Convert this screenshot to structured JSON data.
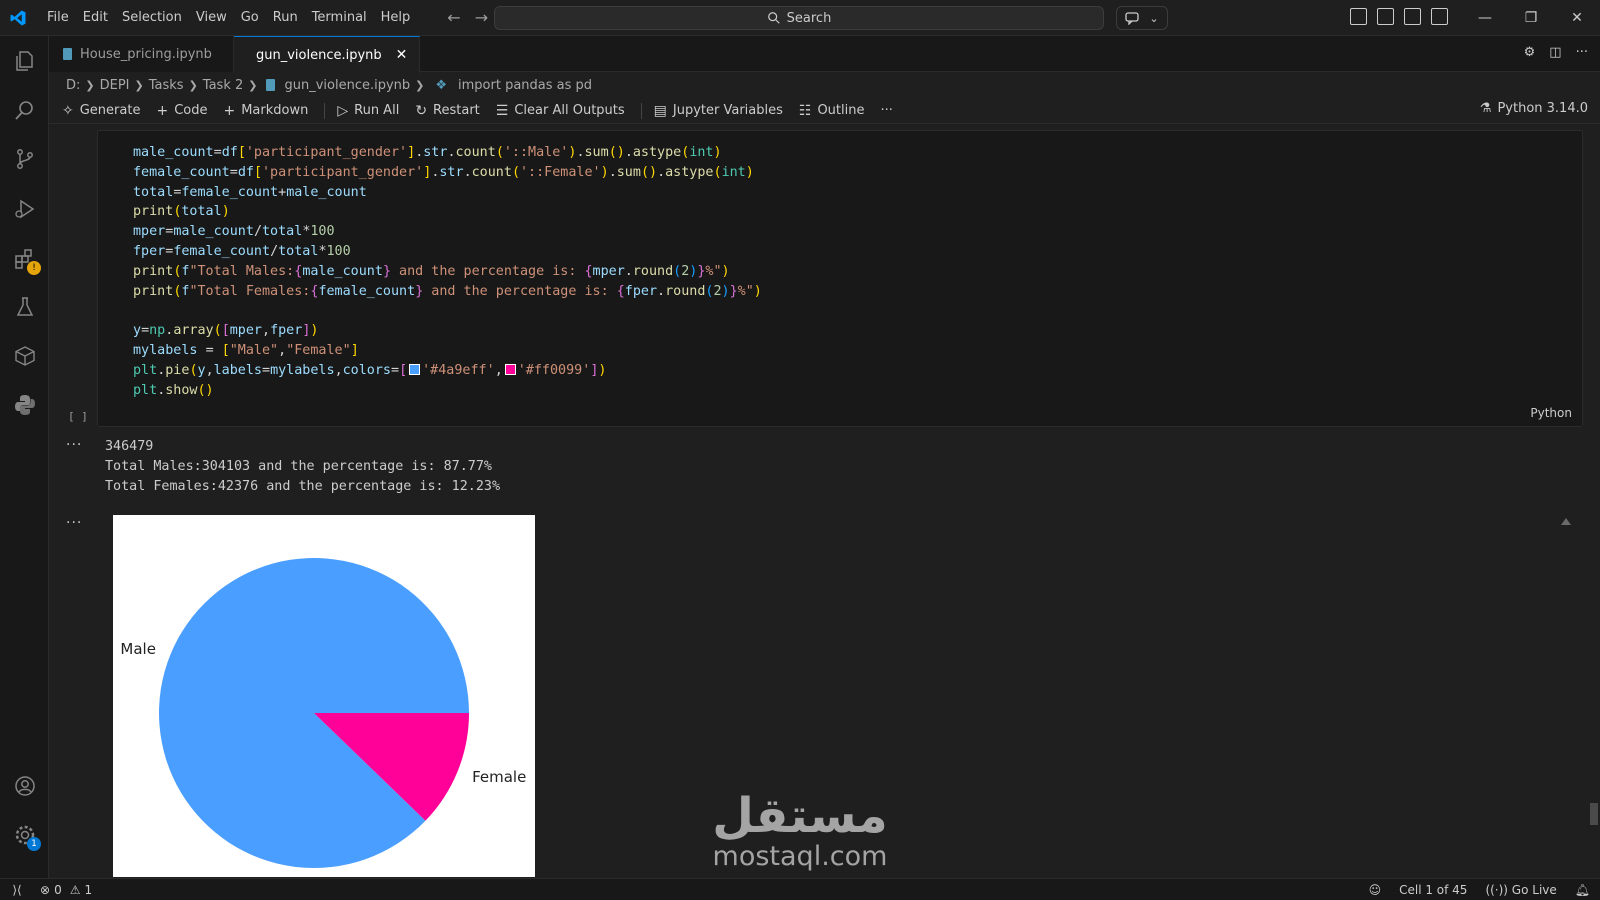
{
  "menu": [
    "File",
    "Edit",
    "Selection",
    "View",
    "Go",
    "Run",
    "Terminal",
    "Help"
  ],
  "search": {
    "label": "Search"
  },
  "tabs": [
    {
      "label": "House_pricing.ipynb",
      "active": false
    },
    {
      "label": "gun_violence.ipynb",
      "active": true
    }
  ],
  "breadcrumb": {
    "items": [
      "D:",
      "DEPI",
      "Tasks",
      "Task 2",
      "gun_violence.ipynb",
      "import pandas as pd"
    ]
  },
  "toolbar": {
    "generate": "Generate",
    "code": "Code",
    "markdown": "Markdown",
    "run_all": "Run All",
    "restart": "Restart",
    "clear_outputs": "Clear All Outputs",
    "variables": "Jupyter Variables",
    "outline": "Outline",
    "more": "···",
    "kernel": "Python 3.14.0"
  },
  "cell": {
    "language": "Python",
    "execution_count": "[ ]",
    "colors": {
      "male": "#4a9eff",
      "female": "#ff0099"
    }
  },
  "output": {
    "lines": [
      "346479",
      "Total Males:304103 and the percentage is: 87.77%",
      "Total Females:42376 and the percentage is: 12.23%"
    ]
  },
  "chart_data": {
    "type": "pie",
    "labels": [
      "Male",
      "Female"
    ],
    "values": [
      87.77,
      12.23
    ],
    "colors": [
      "#4a9eff",
      "#ff0099"
    ]
  },
  "watermark": {
    "arabic": "مستقل",
    "latin": "mostaql.com"
  },
  "status": {
    "errors": "0",
    "warnings": "1",
    "cell_position": "Cell 1 of 45",
    "go_live": "Go Live"
  },
  "accent": "#0078d4",
  "badge_count": "1"
}
